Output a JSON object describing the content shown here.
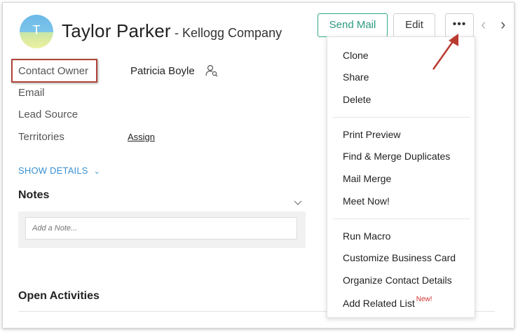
{
  "header": {
    "avatar_initial": "T",
    "name": "Taylor Parker",
    "company": "- Kellogg Company",
    "send_mail_label": "Send Mail",
    "edit_label": "Edit",
    "more_label": "•••",
    "prev_glyph": "‹",
    "next_glyph": "›"
  },
  "fields": {
    "contact_owner_label": "Contact Owner",
    "contact_owner_value": "Patricia Boyle",
    "email_label": "Email",
    "lead_source_label": "Lead Source",
    "territories_label": "Territories",
    "assign_label": "Assign"
  },
  "show_details": {
    "label": "SHOW DETAILS"
  },
  "notes": {
    "title": "Notes",
    "placeholder": "Add a Note..."
  },
  "open_activities": {
    "title": "Open Activities"
  },
  "more_menu": {
    "groups": [
      [
        "Clone",
        "Share",
        "Delete"
      ],
      [
        "Print Preview",
        "Find & Merge Duplicates",
        "Mail Merge",
        "Meet Now!"
      ],
      [
        "Run Macro",
        "Customize Business Card",
        "Organize Contact Details",
        "Add Related List"
      ]
    ],
    "new_badge": "New!"
  },
  "colors": {
    "accent_green": "#2d9a7f",
    "link_blue": "#3a8fd0",
    "highlight_red": "#b0443a",
    "new_badge_red": "#d32f2f"
  }
}
